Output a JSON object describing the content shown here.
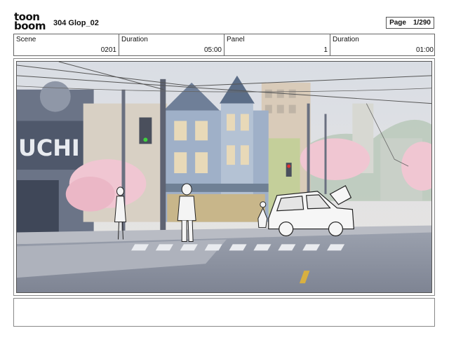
{
  "header": {
    "logo_top": "toon",
    "logo_bottom": "boom",
    "title": "304  Glop_02",
    "page_label": "Page",
    "page_value": "1/290"
  },
  "info": {
    "scene_label": "Scene",
    "scene_value": "0201",
    "duration1_label": "Duration",
    "duration1_value": "05:00",
    "panel_label": "Panel",
    "panel_value": "1",
    "duration2_label": "Duration",
    "duration2_value": "01:00"
  },
  "panel": {
    "sign_text": "UCHI"
  },
  "caption": {
    "text": ""
  }
}
